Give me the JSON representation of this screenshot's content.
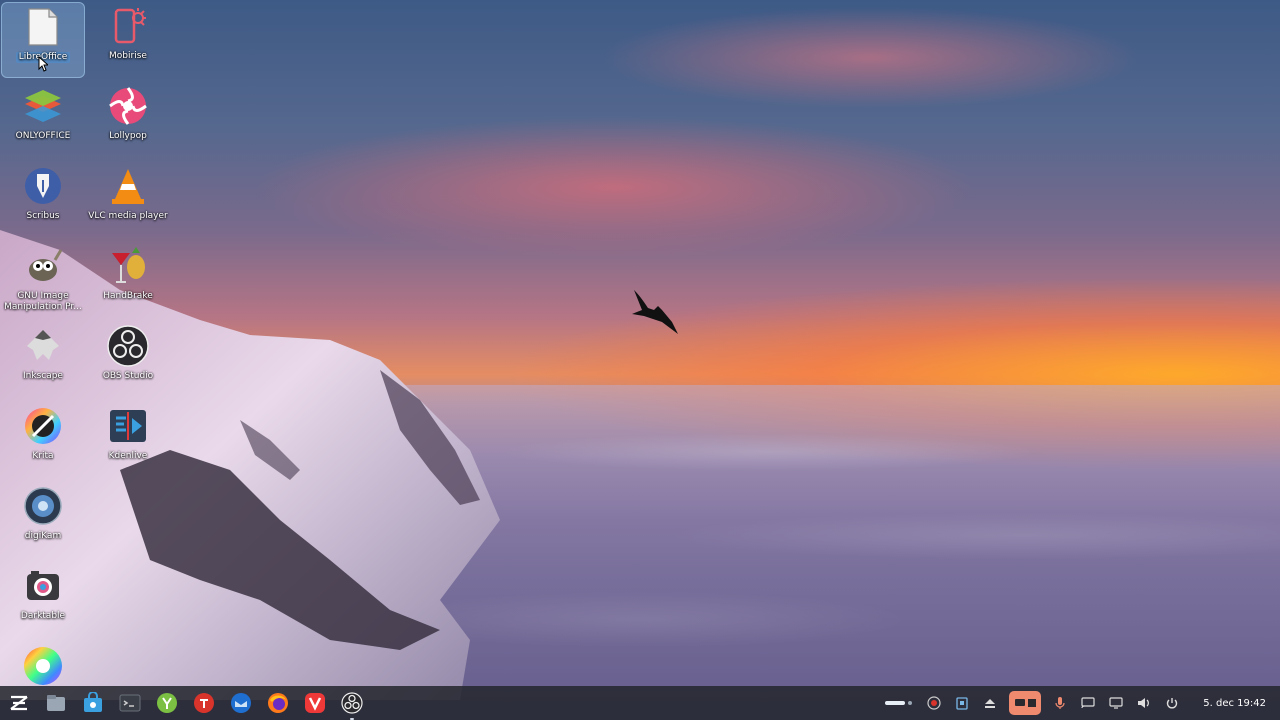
{
  "desktop": {
    "icons": [
      {
        "label": "LibreOffice"
      },
      {
        "label": "Mobirise"
      },
      {
        "label": "ONLYOFFICE"
      },
      {
        "label": "Lollypop"
      },
      {
        "label": "Scribus"
      },
      {
        "label": "VLC media player"
      },
      {
        "label": "GNU Image Manipulation Pr..."
      },
      {
        "label": "HandBrake"
      },
      {
        "label": "Inkscape"
      },
      {
        "label": "OBS Studio"
      },
      {
        "label": "Krita"
      },
      {
        "label": "Kdenlive"
      },
      {
        "label": "digiKam"
      },
      {
        "label": "Darktable"
      }
    ]
  },
  "taskbar": {
    "apps": [
      {
        "icon": "zorin-menu-icon"
      },
      {
        "icon": "files-icon"
      },
      {
        "icon": "software-store-icon"
      },
      {
        "icon": "terminal-icon"
      },
      {
        "icon": "app-y-icon"
      },
      {
        "icon": "app-red-icon"
      },
      {
        "icon": "thunderbird-icon"
      },
      {
        "icon": "firefox-icon"
      },
      {
        "icon": "vivaldi-icon"
      },
      {
        "icon": "obs-studio-icon"
      }
    ],
    "clock": "5. dec  19:42"
  },
  "colors": {
    "accent": "#ef8a6f",
    "taskbar": "#26282f"
  }
}
